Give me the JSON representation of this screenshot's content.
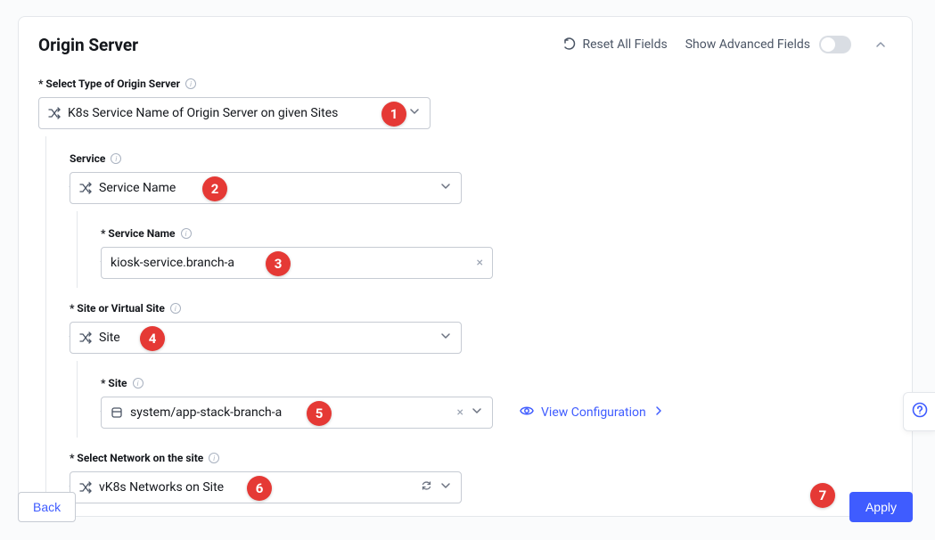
{
  "panel": {
    "title": "Origin Server",
    "reset_label": "Reset All Fields",
    "advanced_label": "Show Advanced Fields"
  },
  "origin_type": {
    "label": "* Select Type of Origin Server",
    "value": "K8s Service Name of Origin Server on given Sites"
  },
  "service": {
    "label": "Service",
    "value": "Service Name",
    "name_label": "* Service Name",
    "name_value": "kiosk-service.branch-a"
  },
  "site": {
    "label": "* Site or Virtual Site",
    "value": "Site",
    "site_label": "* Site",
    "site_value": "system/app-stack-branch-a"
  },
  "network": {
    "label": "* Select Network on the site",
    "value": "vK8s Networks on Site"
  },
  "view_config": "View Configuration",
  "footer": {
    "back": "Back",
    "apply": "Apply"
  },
  "help_glyph": "?",
  "callouts": {
    "c1": "1",
    "c2": "2",
    "c3": "3",
    "c4": "4",
    "c5": "5",
    "c6": "6",
    "c7": "7"
  }
}
